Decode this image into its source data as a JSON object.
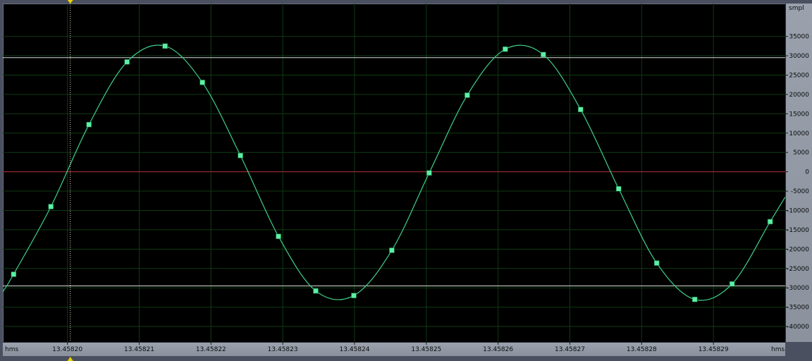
{
  "chart_data": {
    "type": "line",
    "title": "",
    "xlabel": "hms",
    "ylabel": "smpl",
    "x_ticks": [
      "13.45820",
      "13.45821",
      "13.45822",
      "13.45823",
      "13.45824",
      "13.45825",
      "13.45826",
      "13.45827",
      "13.45828",
      "13.45829"
    ],
    "y_ticks": [
      "35000",
      "30000",
      "25000",
      "20000",
      "15000",
      "10000",
      "5000",
      "0",
      "-5000",
      "-10000",
      "-15000",
      "-20000",
      "-25000",
      "-30000",
      "-35000",
      "-40000"
    ],
    "xlim": [
      13.458191,
      13.4583
    ],
    "ylim": [
      -44000,
      43500
    ],
    "reference_lines": [
      29500,
      -29500,
      0
    ],
    "cursor_x": 13.4582004,
    "grid": true,
    "series": [
      {
        "values_x": [
          13.4581925,
          13.4581977,
          13.458203,
          13.4582083,
          13.4582136,
          13.4582188,
          13.4582241,
          13.4582294,
          13.4582346,
          13.4582399,
          13.4582452,
          13.4582504,
          13.4582557,
          13.458261,
          13.4582663,
          13.4582715,
          13.4582768,
          13.4582821,
          13.4582874,
          13.4582926,
          13.4582979
        ],
        "values_y": [
          -26500,
          -9000,
          12200,
          28400,
          32500,
          23100,
          4200,
          -16700,
          -30800,
          -32000,
          -20300,
          -300,
          19800,
          31700,
          30300,
          16100,
          -4400,
          -23600,
          -33000,
          -29000,
          -12900
        ]
      }
    ]
  },
  "colors": {
    "background": "#000000",
    "grid": "#0f3a12",
    "waveform": "#3fd08a",
    "marker": "#5cf0a4",
    "zero_line": "#b3263a",
    "reference_line": "#d8d8d8",
    "cursor": "#e8e8c0",
    "cursor_marker": "#e8d400"
  }
}
